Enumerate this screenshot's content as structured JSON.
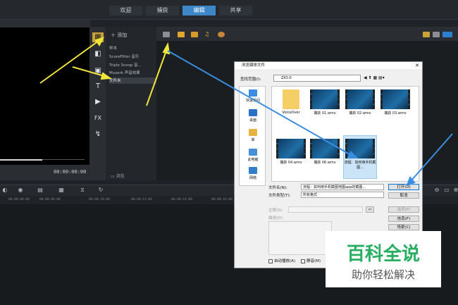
{
  "top_tabs": [
    "欢迎",
    "捕获",
    "编辑",
    "共享"
  ],
  "active_tab": "编辑",
  "preview": {
    "timecode": "00:00:00:00"
  },
  "library": {
    "add_label": "添加",
    "items": [
      "样本",
      "ScoreFitter 音乐",
      "Triple Scoop 音...",
      "Muzerk 声音效果",
      "文件夹"
    ],
    "selected": "文件夹",
    "browse_label": "浏览"
  },
  "timeline": {
    "ticks": [
      "00:00:00:00",
      "00:00:06:00",
      "00:00:10:00",
      "00:00:12:00",
      "00:00:14:00",
      "00:00:16:00"
    ]
  },
  "dialog": {
    "title": "浏览媒体文件",
    "lookin_label": "查找范围(I):",
    "lookin_value": "ZIO.0",
    "places": [
      "快速访问",
      "桌面",
      "库",
      "此电脑",
      "网络"
    ],
    "files": [
      {
        "name": "VoiceOver",
        "kind": "folder"
      },
      {
        "name": "捕获 01.wmv",
        "kind": "video"
      },
      {
        "name": "捕获 02.wmv",
        "kind": "video"
      },
      {
        "name": "捕获 03.wmv",
        "kind": "video"
      },
      {
        "name": "捕获 04.wmv",
        "kind": "video"
      },
      {
        "name": "捕获 06.wmv",
        "kind": "video"
      },
      {
        "name": "流程：如何用手机截图...",
        "kind": "video"
      }
    ],
    "filename_label": "文件名(N):",
    "filename_value": "流程：如何用手机截图地图app的截图...",
    "filetype_label": "文件类型(T):",
    "filetype_value": "所有格式",
    "subject_label": "主题(S):",
    "desc_label": "描述(D):",
    "buttons": {
      "open": "打开(O)",
      "cancel": "取消",
      "options": "选项(P)",
      "info": "信息(F)",
      "scene": "场景(C)"
    },
    "autoplay_label": "自动播放(A)",
    "mute_label": "静音(M)"
  },
  "watermark": {
    "main": "百科全说",
    "sub": "助你轻松解决"
  }
}
